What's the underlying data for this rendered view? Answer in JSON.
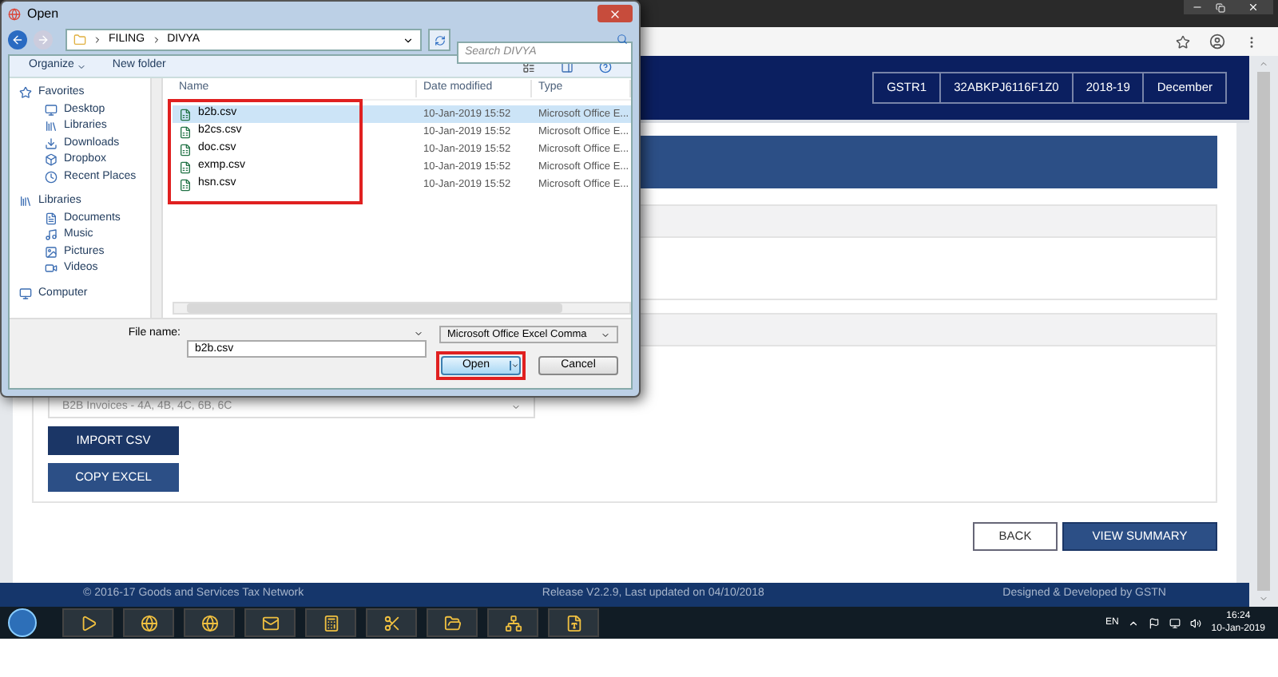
{
  "dialog": {
    "title": "Open",
    "breadcrumb": [
      "FILING",
      "DIVYA"
    ],
    "search": {
      "placeholder": "Search DIVYA"
    },
    "toolbar": [
      "Organize",
      "New folder"
    ],
    "nav": [
      {
        "label": "Favorites",
        "children": [
          {
            "label": "Desktop"
          },
          {
            "label": "Libraries"
          },
          {
            "label": "Downloads"
          },
          {
            "label": "Dropbox"
          },
          {
            "label": "Recent Places"
          }
        ]
      },
      {
        "label": "Libraries",
        "children": [
          {
            "label": "Documents"
          },
          {
            "label": "Music"
          },
          {
            "label": "Pictures"
          },
          {
            "label": "Videos"
          }
        ]
      },
      {
        "label": "Computer"
      }
    ],
    "columns": [
      "Name",
      "Date modified",
      "Type"
    ],
    "files": [
      {
        "name": "b2b.csv",
        "date": "10-Jan-2019 15:52",
        "type": "Microsoft Office E...",
        "selected": true
      },
      {
        "name": "b2cs.csv",
        "date": "10-Jan-2019 15:52",
        "type": "Microsoft Office E...",
        "selected": false
      },
      {
        "name": "doc.csv",
        "date": "10-Jan-2019 15:52",
        "type": "Microsoft Office E...",
        "selected": false
      },
      {
        "name": "exmp.csv",
        "date": "10-Jan-2019 15:52",
        "type": "Microsoft Office E...",
        "selected": false
      },
      {
        "name": "hsn.csv",
        "date": "10-Jan-2019 15:52",
        "type": "Microsoft Office E...",
        "selected": false
      }
    ],
    "file_name": {
      "label": "File name:",
      "value": "b2b.csv"
    },
    "file_type": "Microsoft Office Excel Comma",
    "buttons": [
      {
        "label": "Open",
        "kind": "primary"
      },
      {
        "label": "Cancel",
        "kind": "secondary"
      }
    ]
  },
  "header_badges": [
    "GSTR1",
    "32ABKPJ6116F1Z0",
    "2018-19",
    "December"
  ],
  "return_type_select": "B2B Invoices - 4A, 4B, 4C, 6B, 6C",
  "actions": [
    "IMPORT CSV",
    "COPY EXCEL"
  ],
  "nav_buttons": [
    {
      "label": "BACK",
      "kind": "secondary"
    },
    {
      "label": "VIEW SUMMARY",
      "kind": "primary"
    }
  ],
  "footer": {
    "copyright": "© 2016-17 Goods and Services Tax Network",
    "release": "Release V2.2.9, Last updated on 04/10/2018",
    "credit": "Designed & Developed by GSTN"
  },
  "taskbar": {
    "language": "EN",
    "time": "16:24",
    "date": "10-Jan-2019"
  }
}
